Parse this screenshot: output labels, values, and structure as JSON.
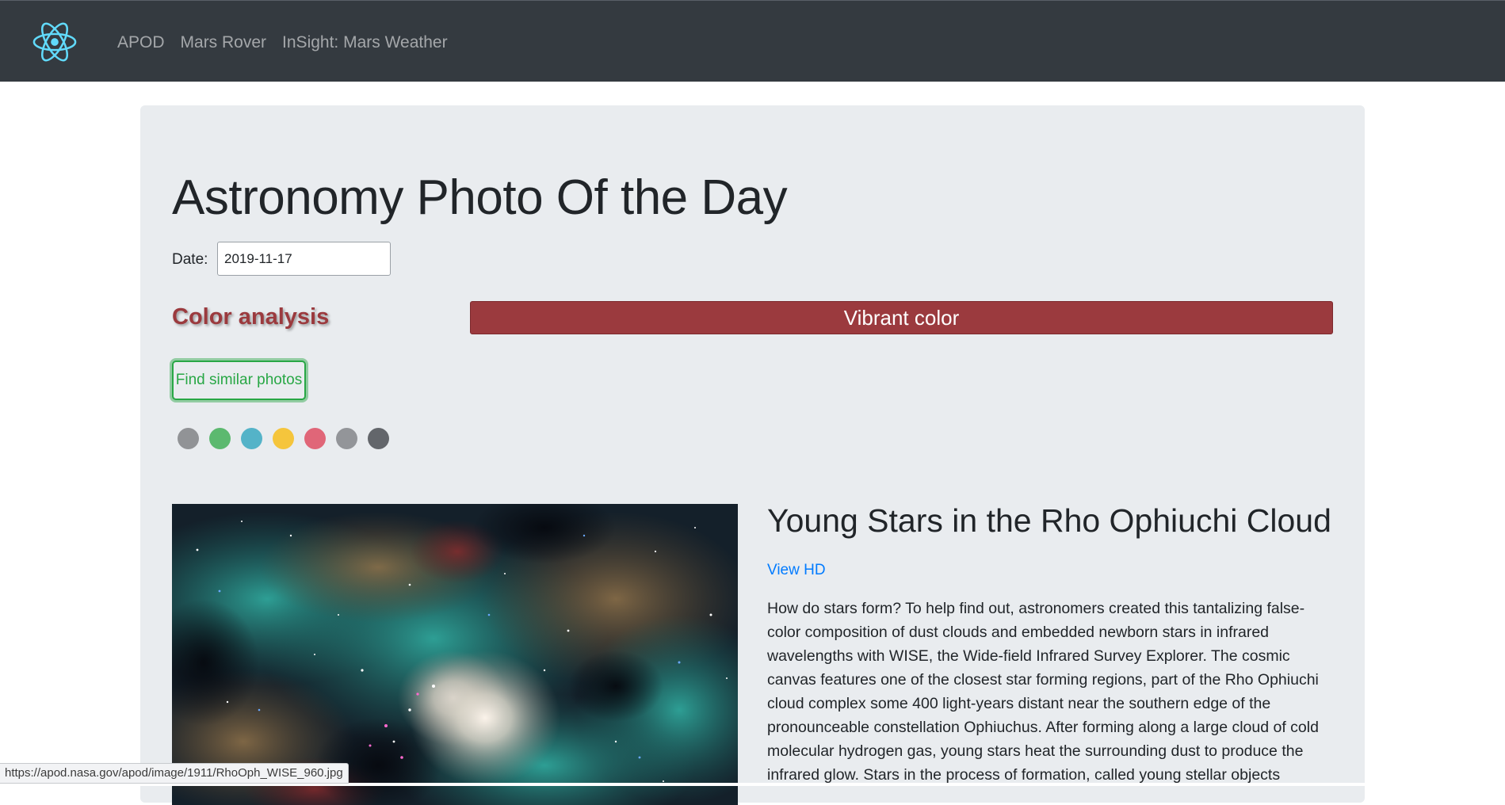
{
  "nav": {
    "logo_icon": "react-atom-icon",
    "links": [
      "APOD",
      "Mars Rover",
      "InSight: Mars Weather"
    ]
  },
  "apod": {
    "title": "Astronomy Photo Of the Day",
    "date_label": "Date:",
    "date_value": "2019-11-17",
    "color_analysis_label": "Color analysis",
    "vibrant_label": "Vibrant color",
    "vibrant_color": "#9b3a3e",
    "find_button": "Find similar photos",
    "swatches": [
      "#919396",
      "#5cb96f",
      "#54b3c8",
      "#f5c53c",
      "#e06678",
      "#939599",
      "#63666b"
    ],
    "photo_title": "Young Stars in the Rho Ophiuchi Cloud",
    "view_hd": "View HD",
    "explanation": "How do stars form? To help find out, astronomers created this tantalizing false-color composition of dust clouds and embedded newborn stars in infrared wavelengths with WISE, the Wide-field Infrared Survey Explorer. The cosmic canvas features one of the closest star forming regions, part of the Rho Ophiuchi cloud complex some 400 light-years distant near the southern edge of the pronounceable constellation Ophiuchus. After forming along a large cloud of cold molecular hydrogen gas, young stars heat the surrounding dust to produce the infrared glow. Stars in the process of formation, called young stellar objects"
  },
  "status_bar": {
    "url": "https://apod.nasa.gov/apod/image/1911/RhoOph_WISE_960.jpg"
  }
}
